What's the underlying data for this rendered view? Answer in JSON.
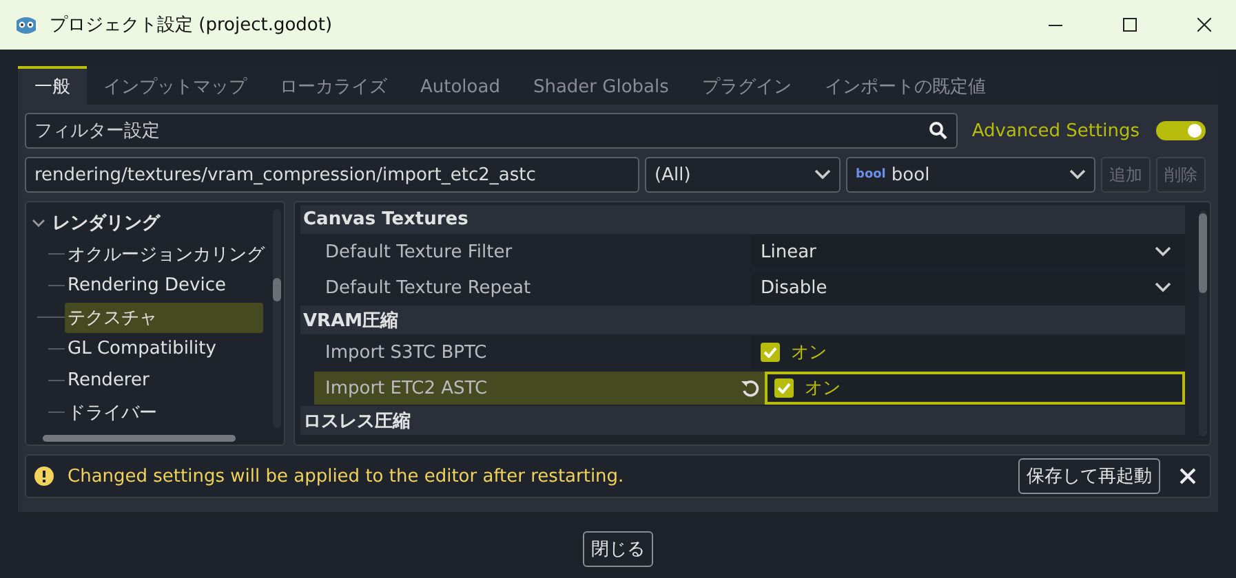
{
  "window": {
    "title": "プロジェクト設定 (project.godot)"
  },
  "tabs": [
    {
      "label": "一般",
      "selected": true
    },
    {
      "label": "インプットマップ",
      "selected": false
    },
    {
      "label": "ローカライズ",
      "selected": false
    },
    {
      "label": "Autoload",
      "selected": false
    },
    {
      "label": "Shader Globals",
      "selected": false
    },
    {
      "label": "プラグイン",
      "selected": false
    },
    {
      "label": "インポートの既定値",
      "selected": false
    }
  ],
  "filter": {
    "placeholder": "フィルター設定"
  },
  "advanced_settings": {
    "label": "Advanced Settings",
    "on": true
  },
  "property_path": {
    "value": "rendering/textures/vram_compression/import_etc2_astc"
  },
  "category_select": {
    "value": "(All)"
  },
  "type_select": {
    "value": "bool",
    "icon_text": "bool"
  },
  "add_button": {
    "label": "追加",
    "disabled": true
  },
  "delete_button": {
    "label": "削除",
    "disabled": true
  },
  "tree": [
    {
      "label": "レンダリング",
      "expanded": true,
      "selected": false,
      "children": [
        {
          "label": "オクルージョンカリング",
          "selected": false
        },
        {
          "label": "Rendering Device",
          "selected": false
        },
        {
          "label": "テクスチャ",
          "selected": true
        },
        {
          "label": "GL Compatibility",
          "selected": false
        },
        {
          "label": "Renderer",
          "selected": false
        },
        {
          "label": "ドライバー",
          "selected": false
        }
      ]
    }
  ],
  "properties": [
    {
      "kind": "section",
      "label": "Canvas Textures"
    },
    {
      "kind": "dropdown",
      "label": "Default Texture Filter",
      "value": "Linear",
      "selected": false,
      "changed": false
    },
    {
      "kind": "dropdown",
      "label": "Default Texture Repeat",
      "value": "Disable",
      "selected": false,
      "changed": false
    },
    {
      "kind": "section",
      "label": "VRAM圧縮"
    },
    {
      "kind": "checkbox",
      "label": "Import S3TC BPTC",
      "value": "オン",
      "checked": true,
      "selected": false,
      "changed": false
    },
    {
      "kind": "checkbox",
      "label": "Import ETC2 ASTC",
      "value": "オン",
      "checked": true,
      "selected": true,
      "changed": true
    },
    {
      "kind": "section",
      "label": "ロスレス圧縮"
    }
  ],
  "notice": {
    "message": "Changed settings will be applied to the editor after restarting.",
    "button": "保存して再起動"
  },
  "close_button": "閉じる"
}
